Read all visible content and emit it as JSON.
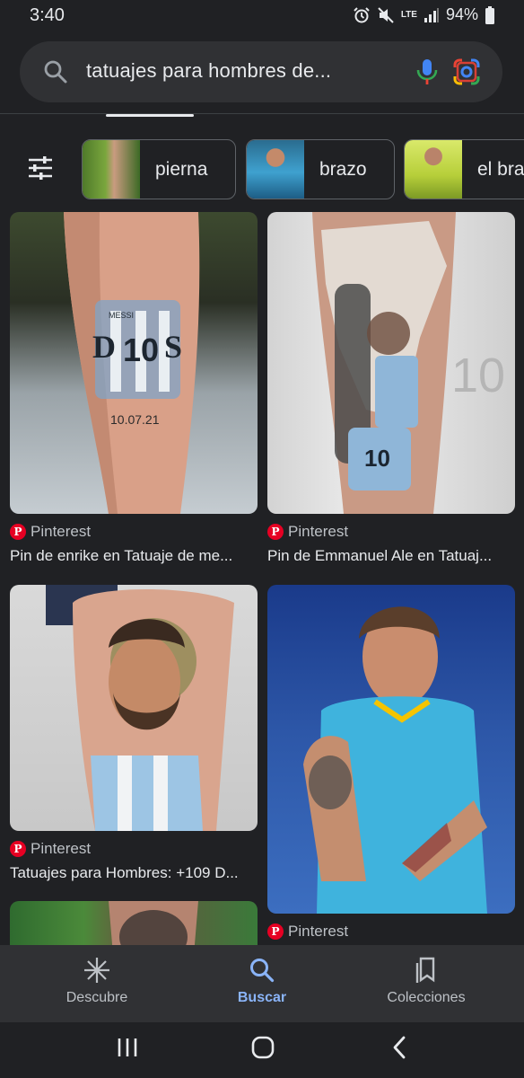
{
  "status_bar": {
    "time": "3:40",
    "network": "LTE",
    "battery": "94%"
  },
  "search": {
    "query": "tatuajes para hombres de..."
  },
  "chips": [
    {
      "label": "pierna"
    },
    {
      "label": "brazo"
    },
    {
      "label": "el bra"
    }
  ],
  "results": [
    {
      "source": "Pinterest",
      "title": "Pin de enrike en Tatuaje de me..."
    },
    {
      "source": "Pinterest",
      "title": "Pin de Emmanuel Ale en Tatuaj..."
    },
    {
      "source": "Pinterest",
      "title": "Tatuajes para Hombres: +109 D..."
    },
    {
      "source": "Pinterest",
      "title": ""
    }
  ],
  "image_text": {
    "d_left": "D",
    "number": "10",
    "s_right": "S",
    "date": "10.07.21",
    "jersey_name": "MESSI"
  },
  "bottom_nav": {
    "discover": "Descubre",
    "search": "Buscar",
    "collections": "Colecciones"
  },
  "colors": {
    "accent": "#8ab4f8",
    "pinterest": "#e60023",
    "background": "#202124"
  }
}
